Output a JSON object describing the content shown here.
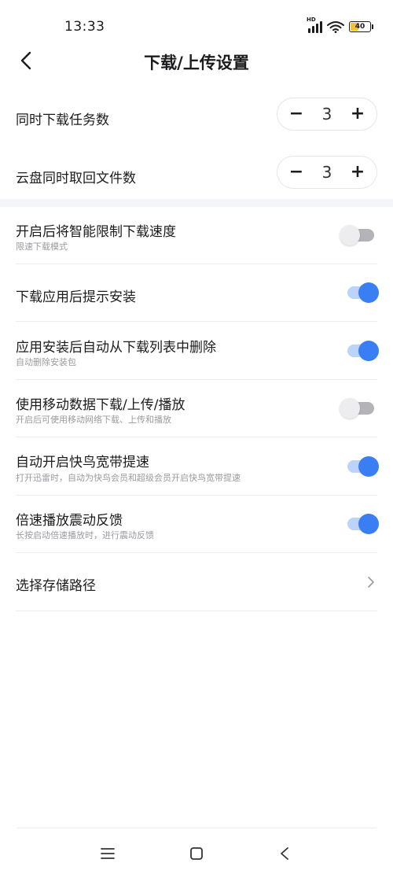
{
  "status_bar": {
    "time": "13:33",
    "network_label": "HD",
    "battery_level": "40",
    "battery_color": "#f2c233"
  },
  "header": {
    "title": "下载/上传设置",
    "back_icon": "chevron-left-icon"
  },
  "steppers": [
    {
      "label": "同时下载任务数",
      "value": "3",
      "minus": "−",
      "plus": "+"
    },
    {
      "label": "云盘同时取回文件数",
      "value": "3",
      "minus": "−",
      "plus": "+"
    }
  ],
  "settings": [
    {
      "title": "开启后将智能限制下载速度",
      "subtitle": "限速下载模式",
      "enabled": false
    },
    {
      "title": "下载应用后提示安装",
      "subtitle": "",
      "enabled": true
    },
    {
      "title": "应用安装后自动从下载列表中删除",
      "subtitle": "自动删除安装包",
      "enabled": true
    },
    {
      "title": "使用移动数据下载/上传/播放",
      "subtitle": "开启后可使用移动网络下载、上传和播放",
      "enabled": false
    },
    {
      "title": "自动开启快鸟宽带提速",
      "subtitle": "打开迅雷时，自动为快鸟会员和超级会员开启快鸟宽带提速",
      "enabled": true
    },
    {
      "title": "倍速播放震动反馈",
      "subtitle": "长按启动倍速播放时，进行震动反馈",
      "enabled": true
    }
  ],
  "storage": {
    "label": "选择存储路径",
    "icon": "chevron-right-icon"
  },
  "colors": {
    "accent": "#3a7ef3",
    "toggle_on_track": "#bcd4fb",
    "toggle_off_track": "#b4b4b8",
    "section_gap": "#f3f5f9"
  },
  "navbar": {
    "menu_icon": "menu-icon",
    "home_icon": "home-square-icon",
    "back_icon": "back-triangle-icon"
  }
}
